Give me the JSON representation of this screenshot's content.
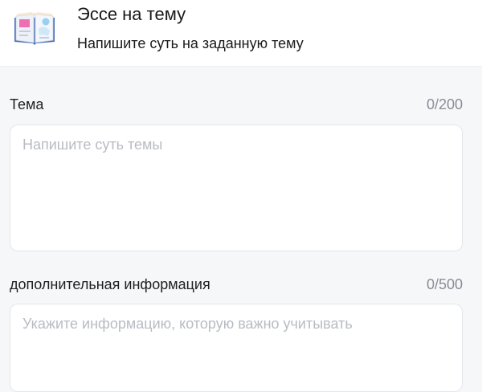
{
  "header": {
    "icon": "open-book-icon",
    "title": "Эссе на тему",
    "subtitle": "Напишите суть на заданную тему"
  },
  "fields": {
    "topic": {
      "label": "Тема",
      "counter": "0/200",
      "value": "",
      "placeholder": "Напишите суть темы"
    },
    "info": {
      "label": "дополнительная информация",
      "counter": "0/500",
      "value": "",
      "placeholder": "Укажите информацию, которую важно учитывать"
    }
  },
  "colors": {
    "background": "#f6f7f9",
    "card": "#ffffff",
    "border": "#e3e6ea",
    "muted_text": "#8a8f98",
    "placeholder": "#b8bcc3"
  }
}
